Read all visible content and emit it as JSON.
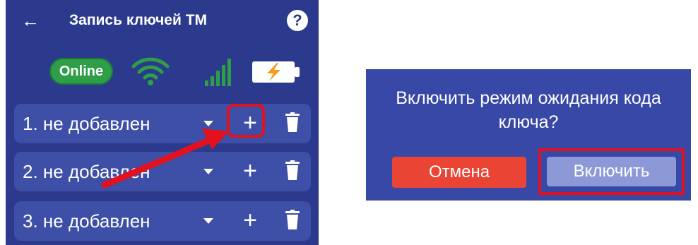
{
  "app": {
    "title": "Запись ключей ТМ",
    "back_icon": "arrow-left-icon",
    "help_icon": "question-icon",
    "help_glyph": "?"
  },
  "status": {
    "online_label": "Online",
    "wifi_icon": "wifi-icon",
    "signal_icon": "signal-bars-icon",
    "battery_icon": "battery-charging-icon"
  },
  "keys": [
    {
      "label": "1. не добавлен",
      "add_glyph": "+"
    },
    {
      "label": "2. не добавлен",
      "add_glyph": "+"
    },
    {
      "label": "3. не добавлен",
      "add_glyph": "+"
    }
  ],
  "dialog": {
    "text": "Включить режим ожидания кода ключа?",
    "cancel_label": "Отмена",
    "confirm_label": "Включить"
  },
  "colors": {
    "panel_bg": "#2b3a8c",
    "row_bg": "#3d4fa6",
    "online_green": "#2e9e48",
    "highlight_red": "#e3101d",
    "cancel_red": "#ea4435",
    "confirm_bg": "#8c99d6"
  }
}
